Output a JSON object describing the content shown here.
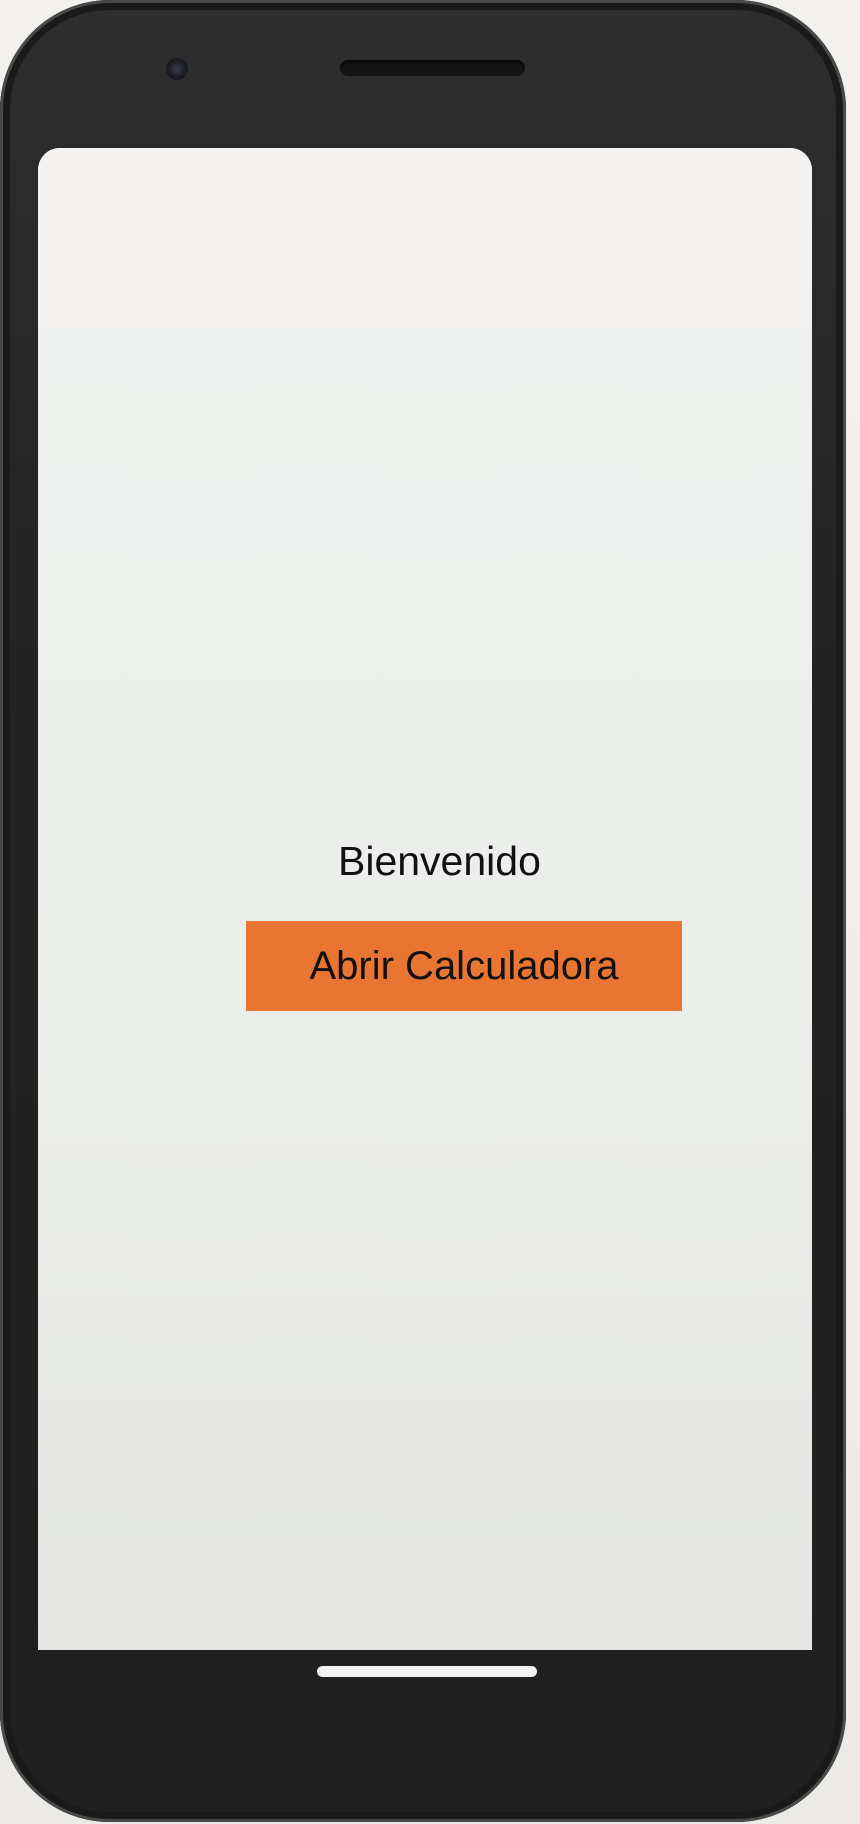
{
  "screen": {
    "welcome_text": "Bienvenido",
    "open_calculator_label": "Abrir Calculadora"
  },
  "colors": {
    "button_background": "#e97532",
    "screen_background": "#edeeec",
    "phone_frame": "#232223"
  }
}
